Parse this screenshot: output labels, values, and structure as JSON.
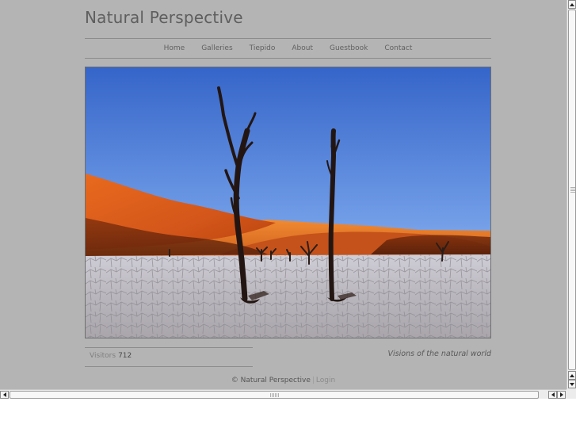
{
  "site": {
    "title": "Natural Perspective"
  },
  "nav": {
    "items": [
      "Home",
      "Galleries",
      "Tiepido",
      "About",
      "Guestbook",
      "Contact"
    ]
  },
  "hero": {
    "subject": "Dead trees on cracked clay pan before orange dunes under blue sky",
    "colors": {
      "sky_top": "#3a6fd1",
      "sky_bottom": "#aac8f2",
      "dune": "#e0661c",
      "ground": "#c9c7cd"
    }
  },
  "visitors": {
    "label": "Visitors",
    "count": "712"
  },
  "tagline": "Visions of the natural world",
  "footer": {
    "copyright": "© Natural Perspective",
    "separator": "|",
    "login": "Login"
  },
  "colors": {
    "page_background": "#b4b4b4",
    "title_text": "#5e5e5e",
    "rule": "#8c8c8c"
  }
}
